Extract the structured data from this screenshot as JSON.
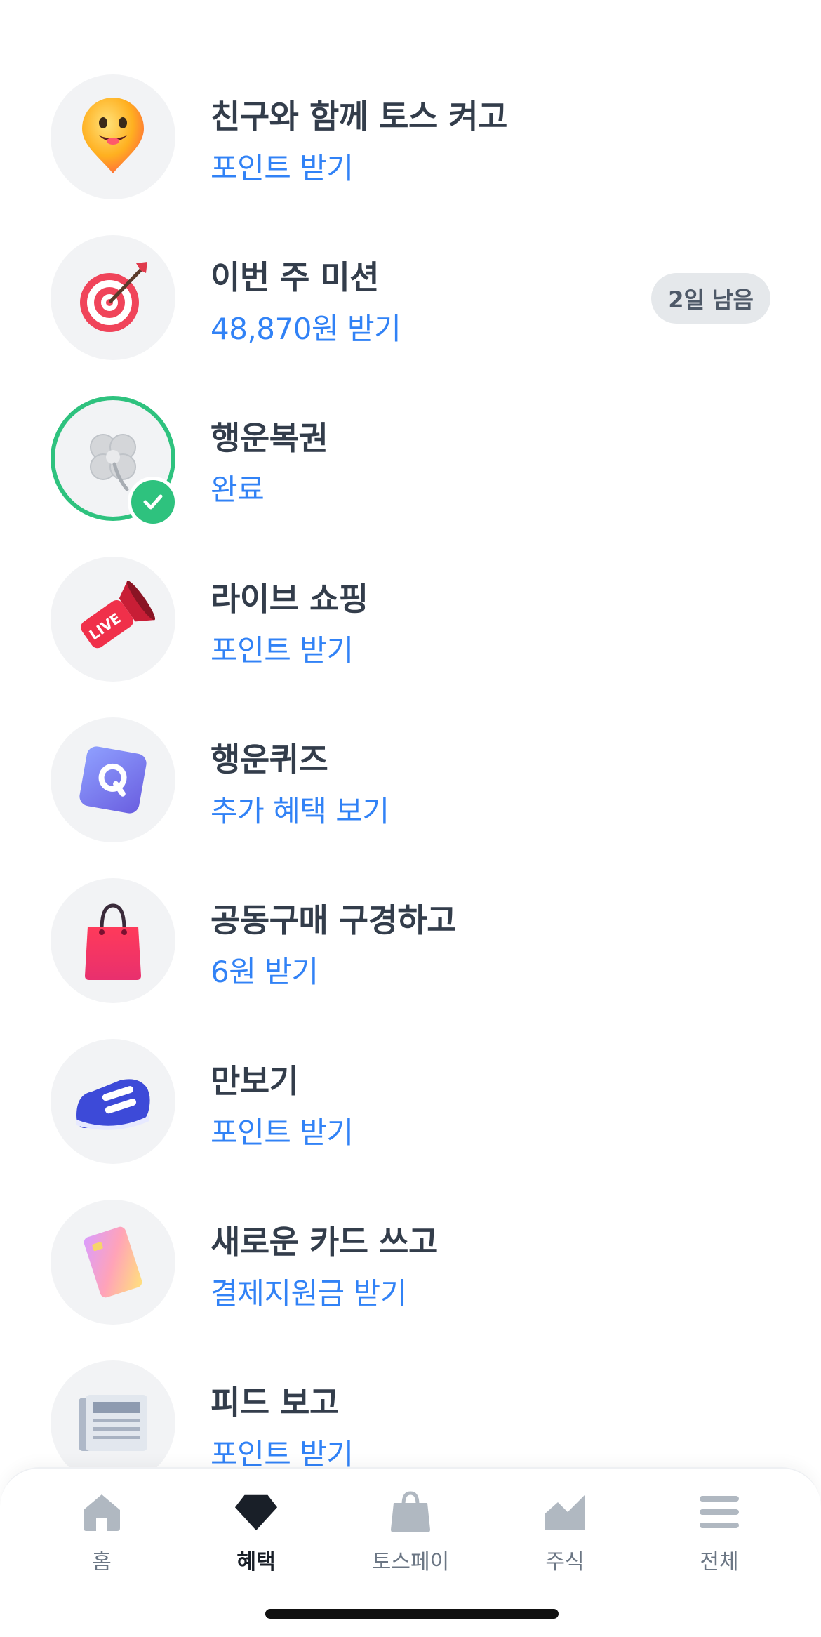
{
  "colors": {
    "accent": "#3182f6",
    "title": "#333d4b",
    "done_green": "#2ec27e",
    "tab_inactive": "#b0b8c1",
    "tab_active": "#191f28"
  },
  "benefits": [
    {
      "title": "친구와 함께 토스 켜고",
      "subtitle": "포인트 받기",
      "icon": "smiley-pin-icon"
    },
    {
      "title": "이번 주 미션",
      "subtitle": "48,870원 받기",
      "icon": "target-dart-icon",
      "badge": "2일 남음"
    },
    {
      "title": "행운복권",
      "subtitle": "완료",
      "icon": "clover-icon",
      "completed": true
    },
    {
      "title": "라이브 쇼핑",
      "subtitle": "포인트 받기",
      "icon": "live-megaphone-icon"
    },
    {
      "title": "행운퀴즈",
      "subtitle": "추가 혜택 보기",
      "icon": "quiz-q-icon"
    },
    {
      "title": "공동구매 구경하고",
      "subtitle": "6원 받기",
      "icon": "shopping-bag-icon"
    },
    {
      "title": "만보기",
      "subtitle": "포인트 받기",
      "icon": "sneaker-icon"
    },
    {
      "title": "새로운 카드 쓰고",
      "subtitle": "결제지원금 받기",
      "icon": "card-icon"
    },
    {
      "title": "피드 보고",
      "subtitle": "포인트 받기",
      "icon": "newspaper-icon"
    }
  ],
  "tabbar": {
    "tabs": [
      {
        "label": "홈",
        "icon": "home-icon"
      },
      {
        "label": "혜택",
        "icon": "gem-icon",
        "active": true
      },
      {
        "label": "토스페이",
        "icon": "bag-icon"
      },
      {
        "label": "주식",
        "icon": "chart-icon"
      },
      {
        "label": "전체",
        "icon": "menu-icon"
      }
    ]
  }
}
